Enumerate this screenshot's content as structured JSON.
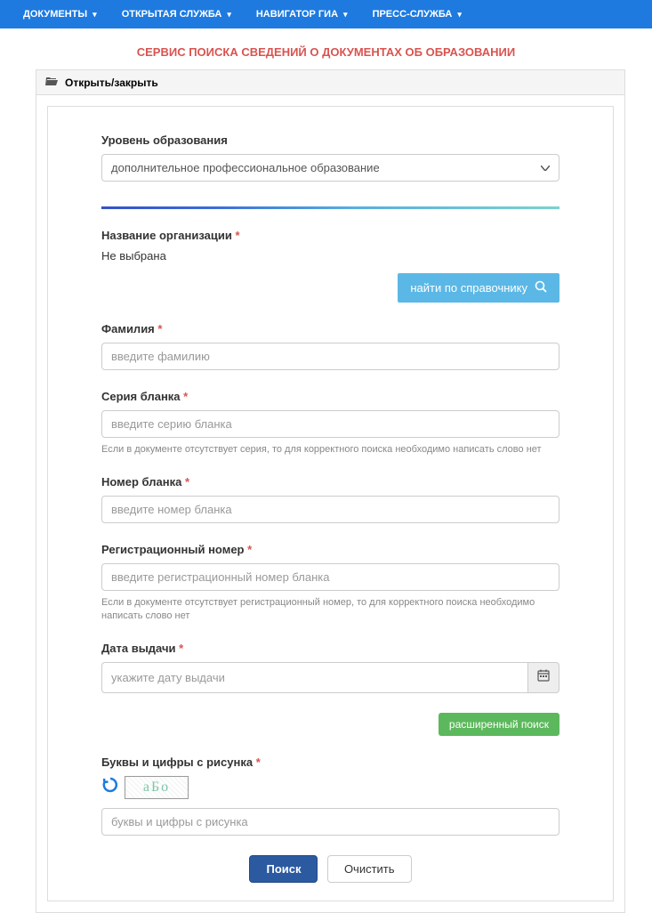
{
  "nav": {
    "items": [
      {
        "label": "ДОКУМЕНТЫ"
      },
      {
        "label": "ОТКРЫТАЯ СЛУЖБА"
      },
      {
        "label": "НАВИГАТОР ГИА"
      },
      {
        "label": "ПРЕСС-СЛУЖБА"
      }
    ]
  },
  "page_title": "СЕРВИС ПОИСКА СВЕДЕНИЙ О ДОКУМЕНТАХ ОБ ОБРАЗОВАНИИ",
  "panel_header": "Открыть/закрыть",
  "form": {
    "level_label": "Уровень образования",
    "level_value": "дополнительное профессиональное образование",
    "org_label": "Название организации",
    "org_value": "Не выбрана",
    "ref_button": "найти по справочнику",
    "surname_label": "Фамилия",
    "surname_placeholder": "введите фамилию",
    "series_label": "Серия бланка",
    "series_placeholder": "введите серию бланка",
    "series_hint": "Если в документе отсутствует серия, то для корректного поиска необходимо написать слово нет",
    "number_label": "Номер бланка",
    "number_placeholder": "введите номер бланка",
    "reg_label": "Регистрационный номер",
    "reg_placeholder": "введите регистрационный номер бланка",
    "reg_hint": "Если в документе отсутствует регистрационный номер, то для корректного поиска необходимо написать слово нет",
    "date_label": "Дата выдачи",
    "date_placeholder": "укажите дату выдачи",
    "advanced_button": "расширенный поиск",
    "captcha_label": "Буквы и цифры с рисунка",
    "captcha_text": "аБо",
    "captcha_placeholder": "буквы и цифры с рисунка",
    "search_button": "Поиск",
    "clear_button": "Очистить"
  }
}
